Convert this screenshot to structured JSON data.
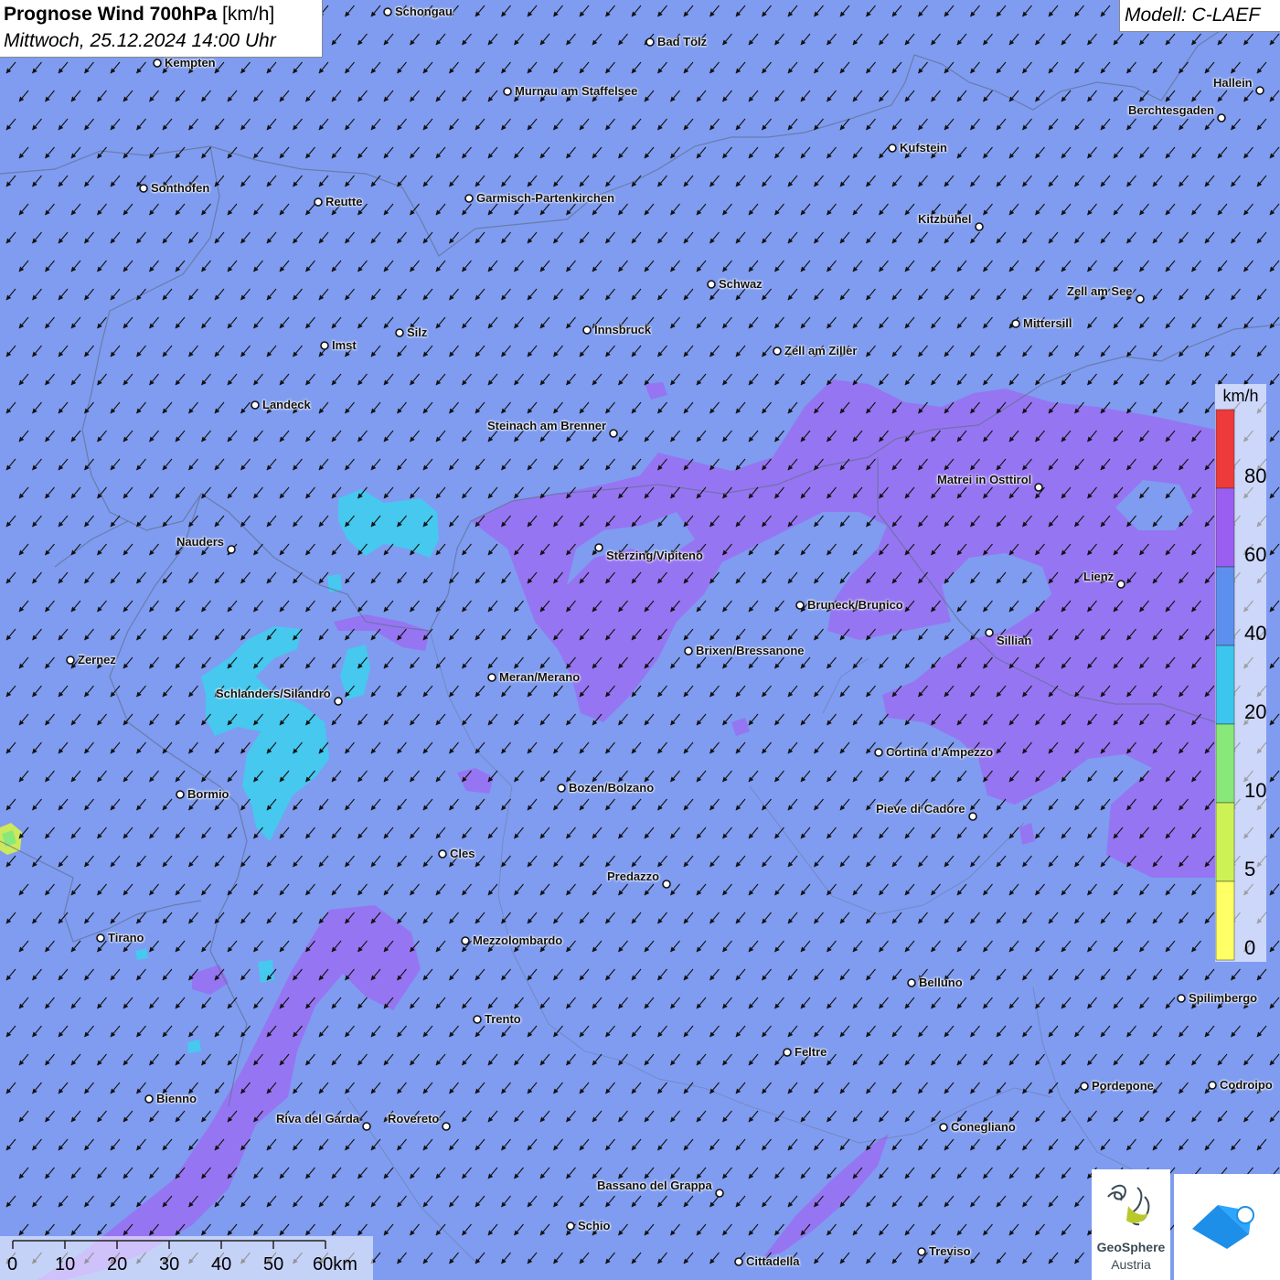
{
  "header": {
    "title_bold": "Prognose Wind 700hPa",
    "title_unit": " [km/h]",
    "datetime": "Mittwoch, 25.12.2024 14:00 Uhr",
    "model": "Modell: C-LAEF"
  },
  "legend": {
    "unit": "km/h",
    "levels": [
      {
        "label": "0",
        "color": "#ffff66"
      },
      {
        "label": "5",
        "color": "#ccf255"
      },
      {
        "label": "10",
        "color": "#88e87a"
      },
      {
        "label": "20",
        "color": "#3cc6ee"
      },
      {
        "label": "40",
        "color": "#5d8fef"
      },
      {
        "label": "60",
        "color": "#9a5ff0"
      },
      {
        "label": "80",
        "color": "#ee3a3a"
      }
    ]
  },
  "scale": {
    "labels": [
      "0",
      "10",
      "20",
      "30",
      "40",
      "50",
      "60km"
    ]
  },
  "logos": {
    "geosphere_line1": "GeoSphere",
    "geosphere_line2": "Austria"
  },
  "cities": [
    {
      "name": "Schongau"
    },
    {
      "name": "Bad Tölz"
    },
    {
      "name": "Kempten"
    },
    {
      "name": "Murnau am Staffelsee"
    },
    {
      "name": "Hallein"
    },
    {
      "name": "Berchtesgaden"
    },
    {
      "name": "Kufstein"
    },
    {
      "name": "Sonthofen"
    },
    {
      "name": "Reutte"
    },
    {
      "name": "Garmisch-Partenkirchen"
    },
    {
      "name": "Kitzbühel"
    },
    {
      "name": "Schwaz"
    },
    {
      "name": "Zell am See"
    },
    {
      "name": "Mittersill"
    },
    {
      "name": "Innsbruck"
    },
    {
      "name": "Silz"
    },
    {
      "name": "Imst"
    },
    {
      "name": "Zell am Ziller"
    },
    {
      "name": "Landeck"
    },
    {
      "name": "Steinach am Brenner"
    },
    {
      "name": "Matrei in Osttirol"
    },
    {
      "name": "Nauders"
    },
    {
      "name": "Sterzing/Vipiteno"
    },
    {
      "name": "Lienz"
    },
    {
      "name": "Bruneck/Brunico"
    },
    {
      "name": "Sillian"
    },
    {
      "name": "Brixen/Bressanone"
    },
    {
      "name": "Zernez"
    },
    {
      "name": "Meran/Merano"
    },
    {
      "name": "Schlanders/Silandro"
    },
    {
      "name": "Cortina d'Ampezzo"
    },
    {
      "name": "Bozen/Bolzano"
    },
    {
      "name": "Bormio"
    },
    {
      "name": "Pieve di Cadore"
    },
    {
      "name": "Cles"
    },
    {
      "name": "Predazzo"
    },
    {
      "name": "Tirano"
    },
    {
      "name": "Mezzolombardo"
    },
    {
      "name": "Belluno"
    },
    {
      "name": "Spilimbergo"
    },
    {
      "name": "Trento"
    },
    {
      "name": "Feltre"
    },
    {
      "name": "Pordenone"
    },
    {
      "name": "Codroipo"
    },
    {
      "name": "Bienno"
    },
    {
      "name": "Riva del Garda"
    },
    {
      "name": "Rovereto"
    },
    {
      "name": "Conegliano"
    },
    {
      "name": "Bassano del Grappa"
    },
    {
      "name": "Schio"
    },
    {
      "name": "Treviso"
    },
    {
      "name": "Cittadella"
    }
  ]
}
